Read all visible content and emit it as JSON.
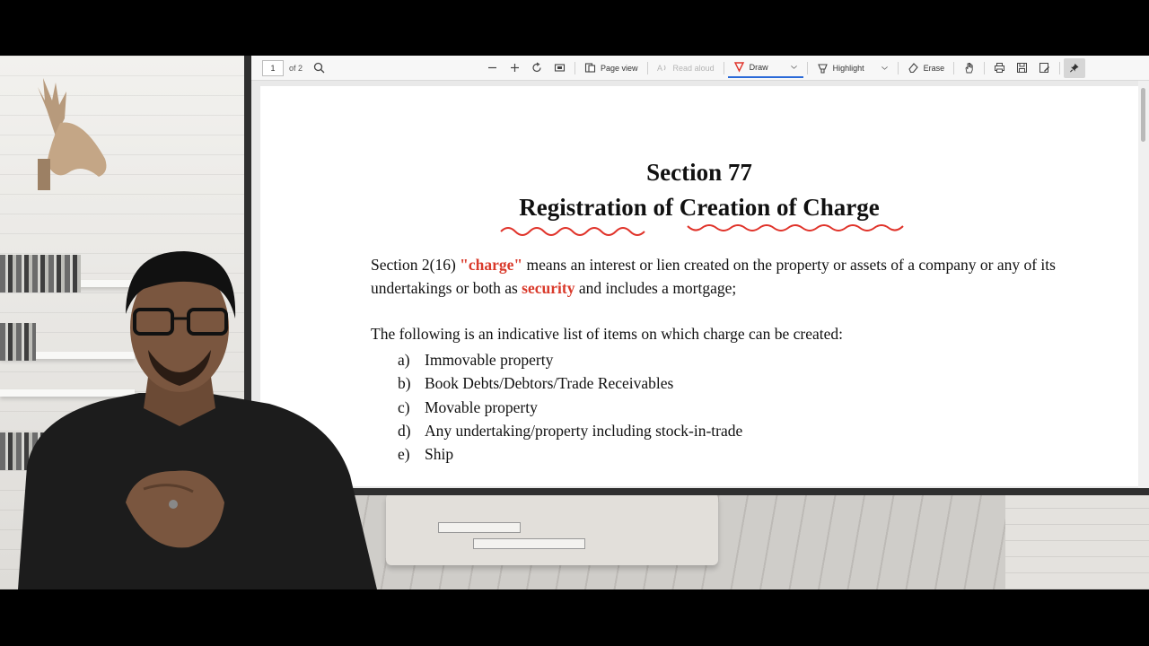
{
  "toolbar": {
    "page_number": "1",
    "page_count": "of 2",
    "page_view_label": "Page view",
    "read_aloud_label": "Read aloud",
    "draw_label": "Draw",
    "highlight_label": "Highlight",
    "erase_label": "Erase"
  },
  "document": {
    "section_number": "Section 77",
    "section_title": "Registration of Creation of Charge",
    "definition": {
      "prefix": "Section 2(16) ",
      "term": "\"charge\"",
      "middle": " means an interest or lien created on the property or assets of a company or any of its undertakings or both as ",
      "keyword": "security",
      "suffix": " and includes a mortgage;"
    },
    "list_intro": "The following is an indicative list of items on which charge can be created:",
    "list_items": [
      {
        "label": "a)",
        "text": "Immovable property"
      },
      {
        "label": "b)",
        "text": "Book Debts/Debtors/Trade Receivables"
      },
      {
        "label": "c)",
        "text": "Movable property"
      },
      {
        "label": "d)",
        "text": "Any undertaking/property including stock-in-trade"
      },
      {
        "label": "e)",
        "text": "Ship"
      }
    ]
  },
  "colors": {
    "accent_red": "#d93a2b",
    "annotation_red": "#e0332a",
    "draw_underline": "#2a6ad8"
  }
}
